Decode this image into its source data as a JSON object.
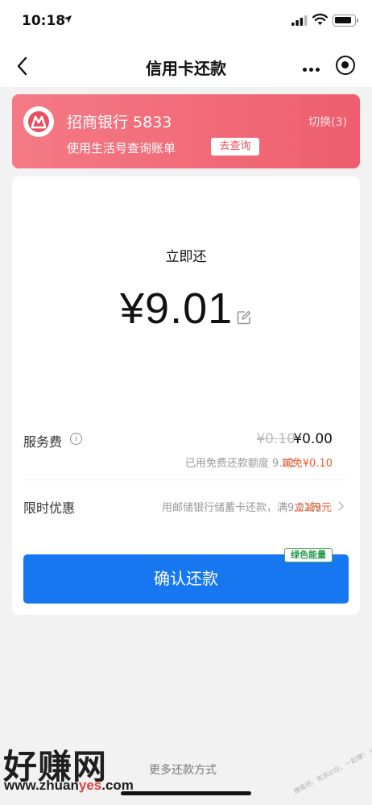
{
  "status_bar": {
    "time": "10:18"
  },
  "nav": {
    "title": "信用卡还款"
  },
  "bank_card": {
    "name": "招商银行 5833",
    "switch_label": "切换(3)",
    "query_text": "使用生活号查询账单",
    "query_button": "去查询"
  },
  "payment": {
    "heading": "立即还",
    "amount": "¥9.01",
    "fee_label": "服务费",
    "fee_original": "¥0.10",
    "fee_current": "¥0.00",
    "fee_note": "已用免费还款额度 9.01",
    "fee_discount": "减免¥0.10",
    "promo_label": "限时优惠",
    "promo_text": "用邮储银行储蓄卡还款，满9.01元",
    "promo_highlight": "立减9元",
    "confirm_button": "确认还款",
    "badge": "绿色能量"
  },
  "footer": {
    "more_methods": "更多还款方式"
  },
  "watermark": {
    "main": "好赚网",
    "url_prefix": "www.zhuan",
    "url_accent": "yes",
    "url_suffix": ".com",
    "stamp": "赚客吧，有求必应，一起赚！ www.zuanke8.com"
  },
  "colors": {
    "brand_red": "#ee5e6e",
    "primary_blue": "#1677f0",
    "discount_orange": "#f45b2a",
    "energy_green": "#2a9a4a"
  }
}
